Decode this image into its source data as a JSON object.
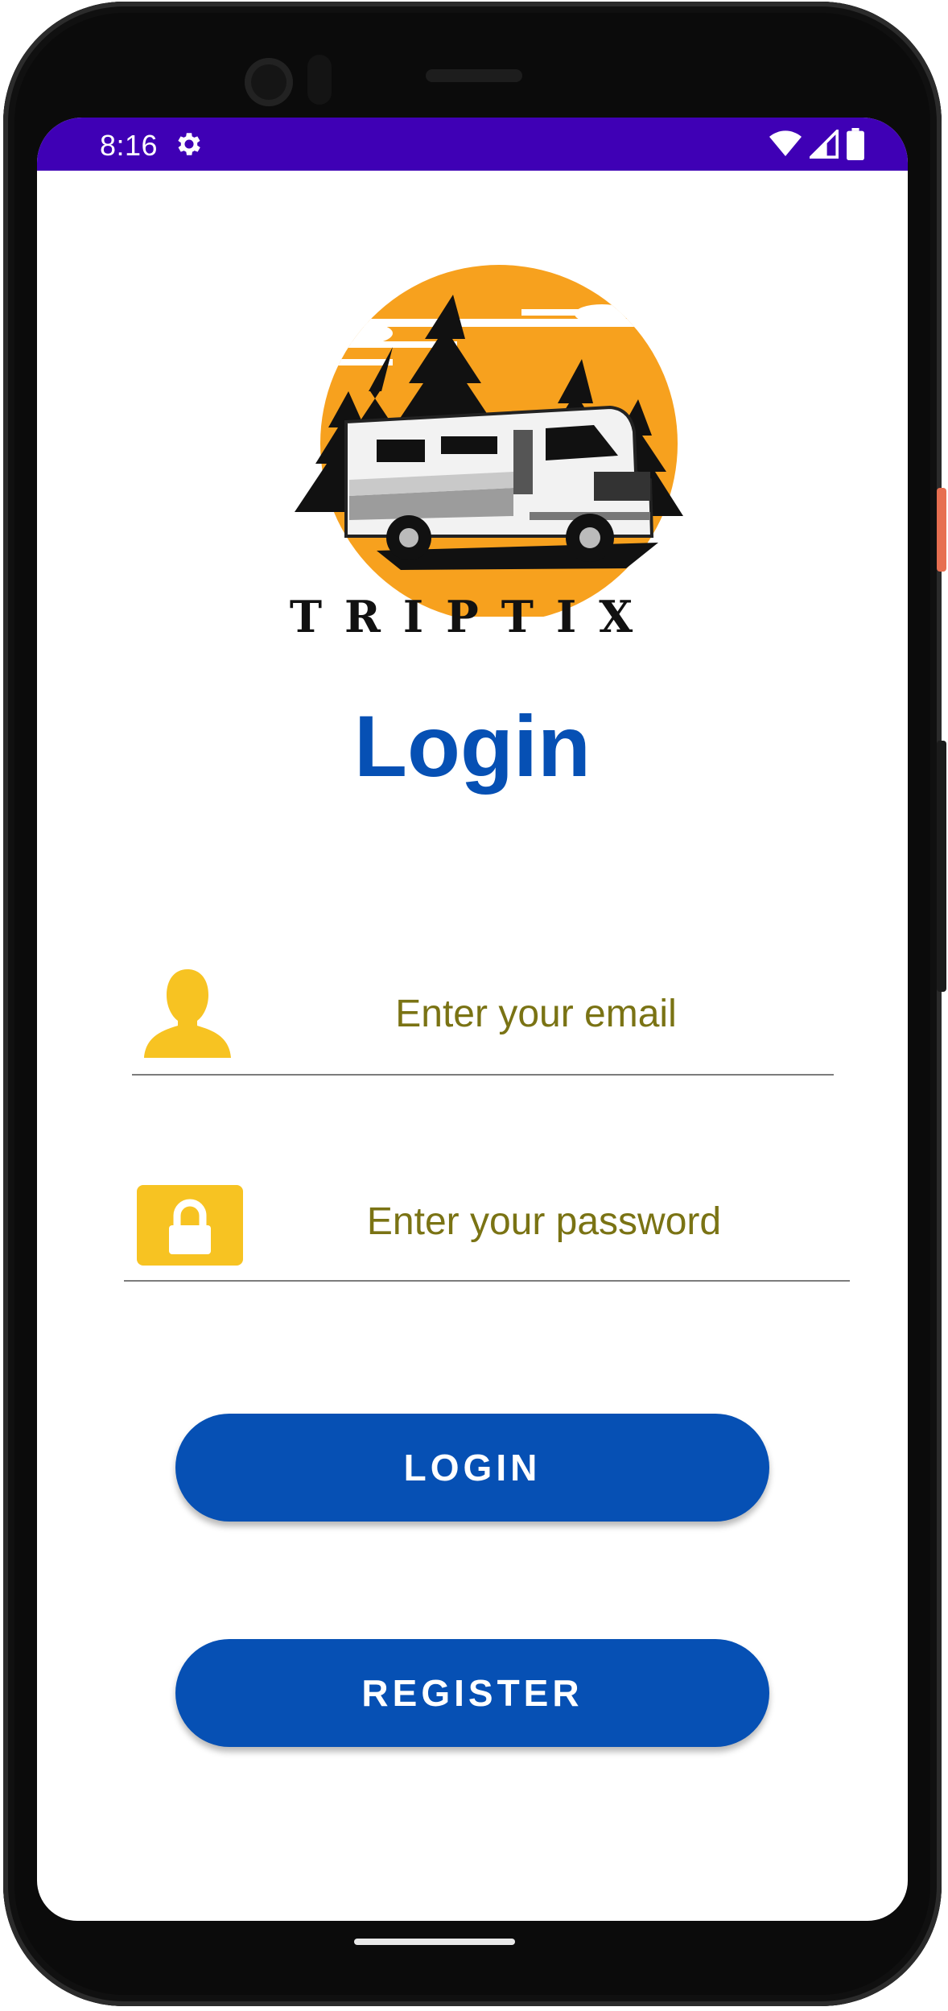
{
  "status_bar": {
    "time": "8:16",
    "icons": [
      "settings-gear-icon",
      "wifi-icon",
      "cellular-signal-icon",
      "battery-icon"
    ],
    "background_color": "#3f00b5"
  },
  "logo": {
    "brand_text": "TRIPTIX",
    "sun_color": "#f7a11e"
  },
  "page_title": "Login",
  "form": {
    "email_placeholder": "Enter your email",
    "password_placeholder": "Enter your password",
    "email_icon": "user-icon",
    "password_icon": "lock-icon",
    "placeholder_color": "#7a7314",
    "icon_color": "#f7c322"
  },
  "buttons": {
    "login_label": "LOGIN",
    "register_label": "REGISTER",
    "color": "#0650b4"
  }
}
